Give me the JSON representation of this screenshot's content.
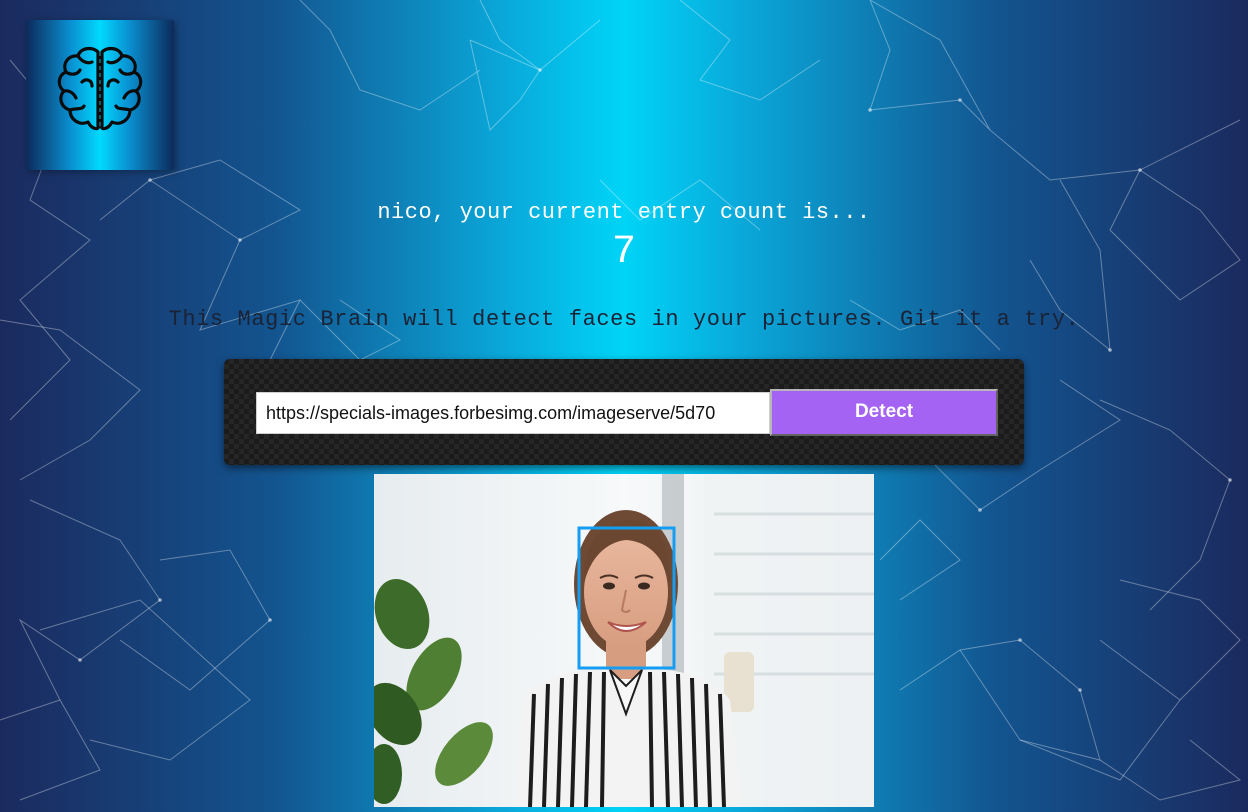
{
  "app": {
    "logo_icon": "brain-icon"
  },
  "rank": {
    "greeting": "nico, your current entry count is...",
    "count": "7"
  },
  "tagline": "This Magic Brain will detect faces in your pictures. Git it a try.",
  "image_form": {
    "url_value": "https://specials-images.forbesimg.com/imageserve/5d70",
    "detect_label": "Detect",
    "accent_color": "#a463f2"
  },
  "result": {
    "image_alt": "portrait photo of smiling woman in striped shirt",
    "face_box_color": "#149df2"
  }
}
